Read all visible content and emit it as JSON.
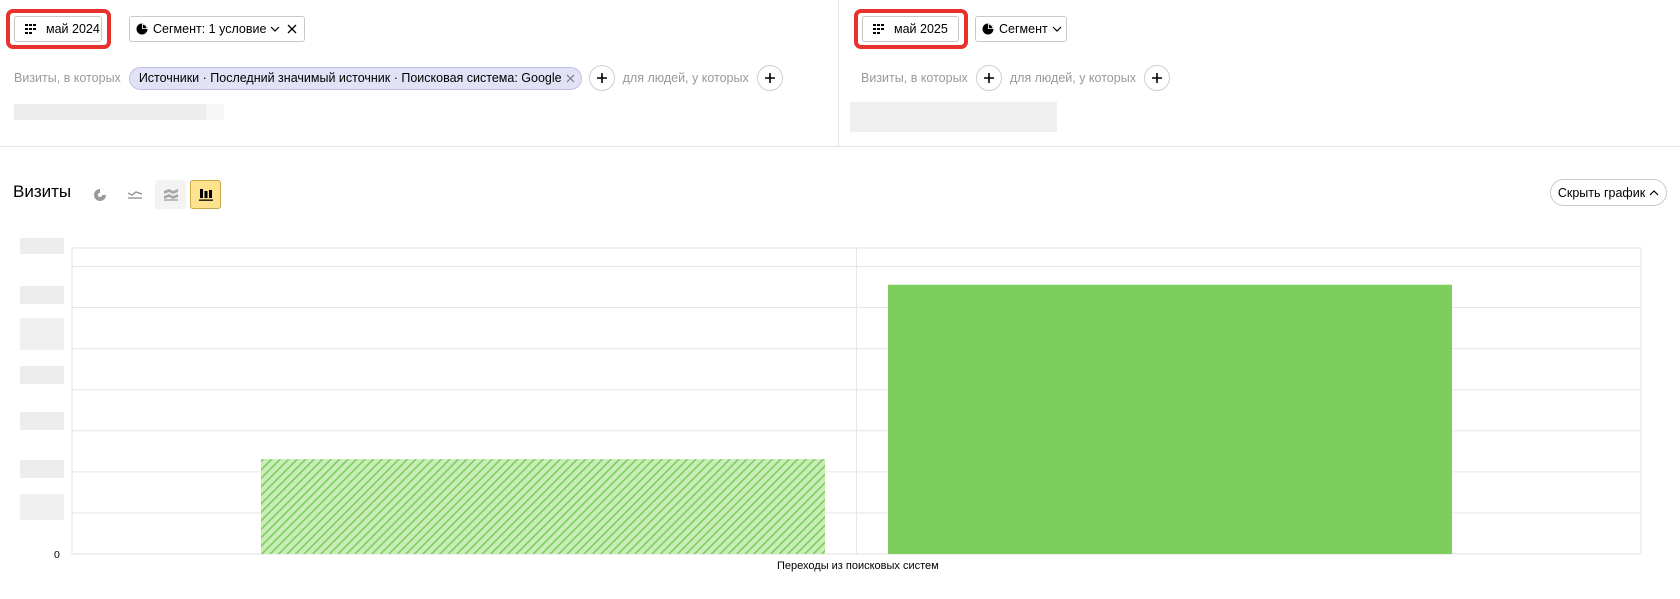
{
  "left_panel": {
    "date_button": "май 2024",
    "segment_button": "Сегмент: 1 условие",
    "visits_label": "Визиты, в которых",
    "chip_text": "Источники · Последний значимый источник · Поисковая система: Google",
    "people_label": "для людей, у которых"
  },
  "right_panel": {
    "date_button": "май 2025",
    "segment_button": "Сегмент",
    "visits_label": "Визиты, в которых",
    "people_label": "для людей, у которых"
  },
  "chart_header": {
    "title": "Визиты",
    "hide_button": "Скрыть график"
  },
  "icons": {
    "calendar": "calendar-grid-icon",
    "segment": "pie-segment-icon",
    "close": "close-icon",
    "chevron": "chevron-down-icon",
    "plus": "plus-icon",
    "chart_types": [
      "pie-chart-icon",
      "line-chart-icon",
      "stacked-area-icon",
      "bar-chart-icon"
    ]
  },
  "colors": {
    "highlight": "#e8322b",
    "bar": "#7dce5d",
    "chip_bg": "#e2e2f7",
    "active_chart_type": "#ffe28e"
  },
  "chart_data": {
    "type": "bar",
    "title": "",
    "categories": [
      "Переходы из поисковых систем"
    ],
    "series": [
      {
        "name": "май 2024",
        "values": [
          0.31
        ],
        "pattern": "hatched"
      },
      {
        "name": "май 2025",
        "values": [
          0.88
        ],
        "pattern": "solid"
      }
    ],
    "ylim": [
      0,
      1
    ],
    "y_tick_labels": [
      "0"
    ],
    "y_tick_count": 7,
    "grid": true,
    "note": "Values normalized to chart height; axis tick labels other than 0 are obscured in the screenshot."
  }
}
